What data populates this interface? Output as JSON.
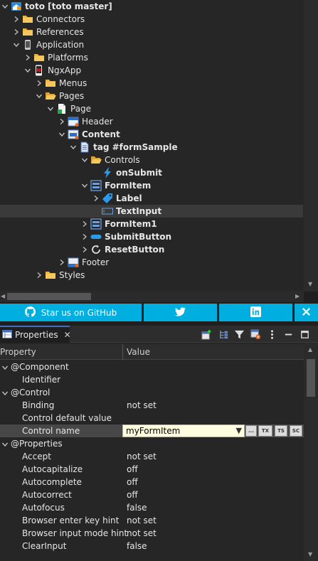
{
  "tree": {
    "items": [
      {
        "label": "toto [toto master]",
        "bold": true,
        "depth": 0,
        "chevron": "down",
        "icon": "project-icon"
      },
      {
        "label": "Connectors",
        "depth": 1,
        "chevron": "right",
        "icon": "folder-icon"
      },
      {
        "label": "References",
        "depth": 1,
        "chevron": "right",
        "icon": "folder-icon"
      },
      {
        "label": "Application",
        "depth": 1,
        "chevron": "down",
        "icon": "mobile-app-icon"
      },
      {
        "label": "Platforms",
        "depth": 2,
        "chevron": "right",
        "icon": "folder-icon"
      },
      {
        "label": "NgxApp",
        "depth": 2,
        "chevron": "down",
        "icon": "ngx-app-icon"
      },
      {
        "label": "Menus",
        "depth": 3,
        "chevron": "right",
        "icon": "folder-icon"
      },
      {
        "label": "Pages",
        "depth": 3,
        "chevron": "down",
        "icon": "folder-open-icon"
      },
      {
        "label": "Page",
        "depth": 4,
        "chevron": "down",
        "icon": "page-icon"
      },
      {
        "label": "Header",
        "depth": 5,
        "chevron": "right",
        "icon": "header-icon"
      },
      {
        "label": "Content",
        "bold": true,
        "depth": 5,
        "chevron": "down",
        "icon": "content-icon"
      },
      {
        "label": "tag #formSample",
        "bold": true,
        "depth": 6,
        "chevron": "down",
        "icon": "tag-doc-icon"
      },
      {
        "label": "Controls",
        "depth": 7,
        "chevron": "down",
        "icon": "folder-open-icon"
      },
      {
        "label": "onSubmit",
        "bold": true,
        "depth": 8,
        "chevron": "none",
        "icon": "lightning-icon"
      },
      {
        "label": "FormItem",
        "bold": true,
        "depth": 7,
        "chevron": "down",
        "icon": "form-item-icon"
      },
      {
        "label": "Label",
        "bold": true,
        "depth": 8,
        "chevron": "right",
        "icon": "label-tag-icon"
      },
      {
        "label": "TextInput",
        "bold": true,
        "depth": 8,
        "chevron": "none",
        "icon": "text-input-icon",
        "selected": true
      },
      {
        "label": "FormItem1",
        "bold": true,
        "depth": 7,
        "chevron": "right",
        "icon": "form-item-icon"
      },
      {
        "label": "SubmitButton",
        "bold": true,
        "depth": 7,
        "chevron": "right",
        "icon": "button-pill-icon"
      },
      {
        "label": "ResetButton",
        "bold": true,
        "depth": 7,
        "chevron": "right",
        "icon": "reset-icon"
      },
      {
        "label": "Footer",
        "depth": 5,
        "chevron": "right",
        "icon": "footer-icon"
      },
      {
        "label": "Styles",
        "depth": 3,
        "chevron": "right",
        "icon": "folder-icon"
      }
    ]
  },
  "social": {
    "github_label": "Star us on GitHub",
    "twitter_icon": "twitter-icon",
    "linkedin_icon": "linkedin-icon",
    "close_icon": "close-icon",
    "color": "#00aee0"
  },
  "panel": {
    "tab_label": "Properties",
    "tab_close": "✕",
    "toolbar_icons": [
      "new-property-icon",
      "tree-view-icon",
      "filter-icon",
      "settings-icon",
      "more-vert-icon",
      "minimize-icon",
      "maximize-icon"
    ],
    "col_property": "Property",
    "col_value": "Value",
    "rows": [
      {
        "kind": "group",
        "name": "@Component"
      },
      {
        "kind": "prop",
        "name": "Identifier",
        "value": ""
      },
      {
        "kind": "group",
        "name": "@Control"
      },
      {
        "kind": "prop",
        "name": "Binding",
        "value": "not set"
      },
      {
        "kind": "prop",
        "name": "Control default value",
        "value": ""
      },
      {
        "kind": "edit",
        "name": "Control name",
        "value": "myFormItem"
      },
      {
        "kind": "group",
        "name": "@Properties"
      },
      {
        "kind": "prop",
        "name": "Accept",
        "value": "not set"
      },
      {
        "kind": "prop",
        "name": "Autocapitalize",
        "value": "off"
      },
      {
        "kind": "prop",
        "name": "Autocomplete",
        "value": "off"
      },
      {
        "kind": "prop",
        "name": "Autocorrect",
        "value": "off"
      },
      {
        "kind": "prop",
        "name": "Autofocus",
        "value": "false"
      },
      {
        "kind": "prop",
        "name": "Browser enter key hint",
        "value": "not set"
      },
      {
        "kind": "prop",
        "name": "Browser input mode hint",
        "value": "not set"
      },
      {
        "kind": "prop",
        "name": "ClearInput",
        "value": "false"
      }
    ],
    "editor_buttons": [
      "...",
      "TX",
      "TS",
      "SC"
    ]
  }
}
